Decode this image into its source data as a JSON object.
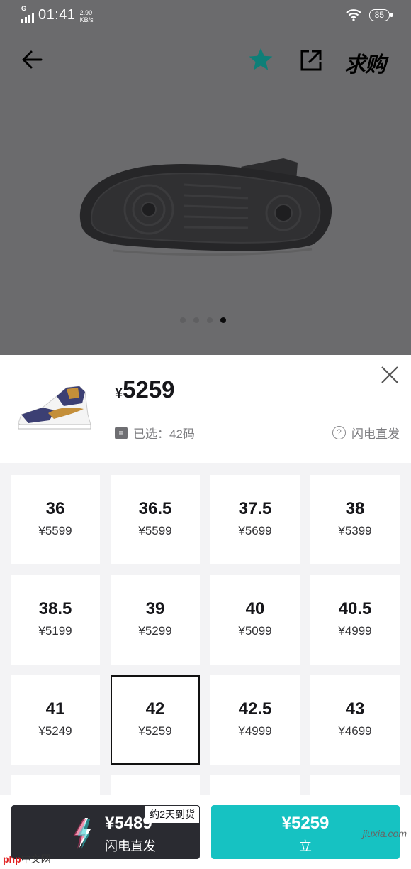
{
  "status_bar": {
    "network_type": "G",
    "time": "01:41",
    "speed_value": "2.90",
    "speed_unit": "KB/s",
    "battery": "85"
  },
  "nav": {
    "want_label": "求购"
  },
  "carousel": {
    "page_count": 4,
    "active_index": 3
  },
  "sheet": {
    "price_symbol": "¥",
    "price": "5259",
    "selected_label": "已选：42码",
    "flash_label": "闪电直发"
  },
  "sizes": [
    {
      "size": "36",
      "price": "¥5599"
    },
    {
      "size": "36.5",
      "price": "¥5599"
    },
    {
      "size": "37.5",
      "price": "¥5699"
    },
    {
      "size": "38",
      "price": "¥5399"
    },
    {
      "size": "38.5",
      "price": "¥5199"
    },
    {
      "size": "39",
      "price": "¥5299"
    },
    {
      "size": "40",
      "price": "¥5099"
    },
    {
      "size": "40.5",
      "price": "¥4999"
    },
    {
      "size": "41",
      "price": "¥5249"
    },
    {
      "size": "42",
      "price": "¥5259",
      "selected": true
    },
    {
      "size": "42.5",
      "price": "¥4999"
    },
    {
      "size": "43",
      "price": "¥4699"
    }
  ],
  "bottom": {
    "flash_badge": "约2天到货",
    "flash_price": "¥5489",
    "flash_label": "闪电直发",
    "buy_price": "¥5259",
    "buy_label": "立"
  },
  "watermarks": {
    "left_brand": "php",
    "left_text": "中文网",
    "right_text": "jiuxia.com"
  },
  "colors": {
    "accent": "#16c2c2",
    "dark_button": "#2a2b31",
    "overlay": "#6b6b6d",
    "favorite": "#0e7f78"
  }
}
